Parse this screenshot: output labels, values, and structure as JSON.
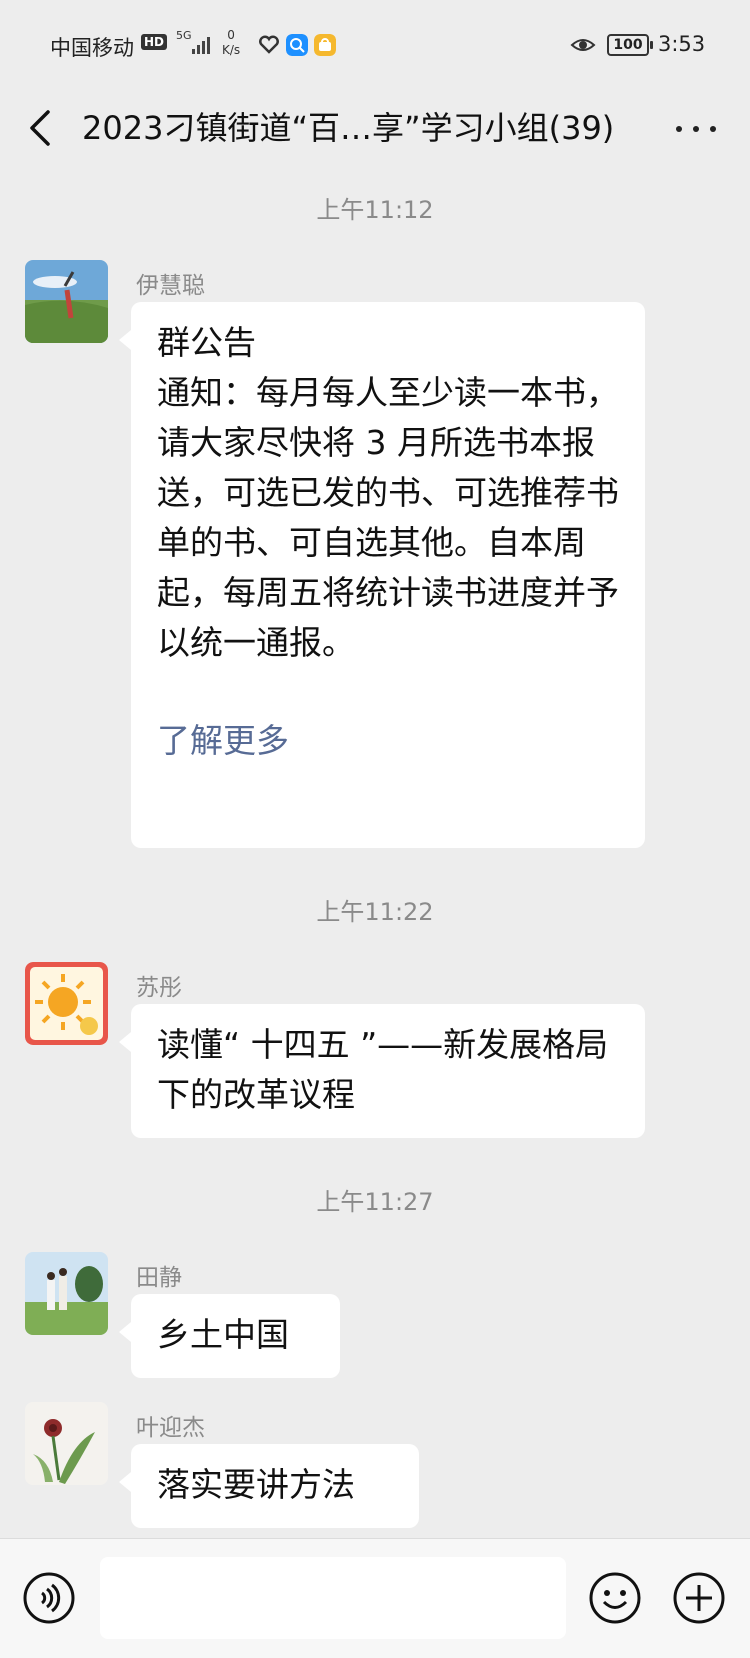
{
  "status_bar": {
    "carrier": "中国移动",
    "hd_badge": "HD",
    "network": "5G",
    "speed_value": "0",
    "speed_unit": "K/s",
    "battery": "100",
    "time": "3:53"
  },
  "header": {
    "title": "2023刁镇街道“百…享”学习小组(39)",
    "back_icon": "chevron-left-icon",
    "more_icon": "more-dots-icon"
  },
  "messages": [
    {
      "timestamp": "上午11:12",
      "sender": "伊慧聪",
      "announcement_title": "群公告",
      "announcement_body": "通知：每月每人至少读一本书，请大家尽快将 3 月所选书本报送，可选已发的书、可选推荐书单的书、可自选其他。自本周起，每周五将统计读书进度并予以统一通报。",
      "link_text": "了解更多"
    },
    {
      "timestamp": "上午11:22",
      "sender": "苏彤",
      "text": "读懂“ 十四五 ”——新发展格局下的改革议程"
    },
    {
      "timestamp": "上午11:27",
      "sender": "田静",
      "text": "乡土中国"
    },
    {
      "sender": "叶迎杰",
      "text": "落实要讲方法"
    }
  ],
  "input_bar": {
    "voice_icon": "voice-icon",
    "emoji_icon": "emoji-icon",
    "add_icon": "plus-icon",
    "placeholder": ""
  },
  "colors": {
    "background": "#ededed",
    "bubble": "#ffffff",
    "link": "#576b95",
    "timestamp": "#8a8a8a"
  }
}
